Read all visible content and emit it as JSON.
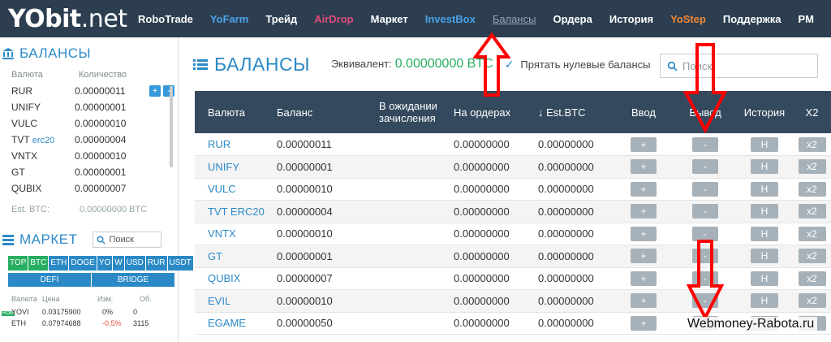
{
  "nav": {
    "logo_main": "YObit",
    "logo_suffix": ".net",
    "items": [
      {
        "label": "RoboTrade",
        "style": "white"
      },
      {
        "label": "YoFarm",
        "style": "blue"
      },
      {
        "label": "Трейд",
        "style": "white"
      },
      {
        "label": "AirDrop",
        "style": "pink"
      },
      {
        "label": "Маркет",
        "style": "white"
      },
      {
        "label": "InvestBox",
        "style": "blue"
      },
      {
        "label": "Балансы",
        "style": "active"
      },
      {
        "label": "Ордера",
        "style": "white"
      },
      {
        "label": "История",
        "style": "white"
      },
      {
        "label": "YoStep",
        "style": "orange"
      },
      {
        "label": "Поддержка",
        "style": "white"
      },
      {
        "label": "PM",
        "style": "white"
      }
    ]
  },
  "sidebar": {
    "title": "БАЛАНСЫ",
    "col_currency": "Валюта",
    "col_amount": "Количество",
    "rows": [
      {
        "currency": "RUR",
        "suffix": "",
        "amount": "0.00000011"
      },
      {
        "currency": "UNIFY",
        "suffix": "",
        "amount": "0.00000001"
      },
      {
        "currency": "VULC",
        "suffix": "",
        "amount": "0.00000010"
      },
      {
        "currency": "TVT",
        "suffix": "erc20",
        "amount": "0.00000004"
      },
      {
        "currency": "VNTX",
        "suffix": "",
        "amount": "0.00000010"
      },
      {
        "currency": "GT",
        "suffix": "",
        "amount": "0.00000001"
      },
      {
        "currency": "QUBIX",
        "suffix": "",
        "amount": "0.00000007"
      }
    ],
    "plus_label": "+",
    "minus_label": "-",
    "est_label": "Est. BTC:",
    "est_value": "0.00000000 BTC"
  },
  "market": {
    "title": "МАРКЕТ",
    "search_placeholder": "Поиск",
    "tabs": [
      "TOP",
      "BTC",
      "ETH",
      "DOGE",
      "YO",
      "W",
      "USD",
      "RUR",
      "USDT"
    ],
    "selected_tab": "BTC",
    "sub_tabs": [
      "DEFI",
      "BRIDGE"
    ],
    "col_currency": "Валюта",
    "col_price": "Цена",
    "col_change": "Изм.",
    "col_volume": "Об.",
    "rows": [
      {
        "badge": "ROM",
        "currency": "YOVI",
        "price": "0.03175900",
        "change": "0%",
        "volume": "0"
      },
      {
        "badge": "",
        "currency": "ETH",
        "price": "0.07974688",
        "change": "-0.5%",
        "volume": "3115"
      }
    ]
  },
  "main": {
    "title": "БАЛАНСЫ",
    "equiv_label": "Эквивалент:",
    "equiv_value": "0.00000000 BTC",
    "hide_zero_label": "Прятать нулевые балансы",
    "search_placeholder": "Поиск",
    "headers": {
      "currency": "Валюта",
      "balance": "Баланс",
      "pending": "В ожидании зачисления",
      "orders": "На ордерах",
      "est": "↓ Est.BTC",
      "deposit": "Ввод",
      "withdraw": "Вывод",
      "history": "История",
      "x2": "X2"
    },
    "deposit_btn": "+",
    "withdraw_btn": "-",
    "history_btn": "H",
    "x2_btn": "x2",
    "rows": [
      {
        "currency": "RUR",
        "balance": "0.00000011",
        "orders": "0.00000000",
        "est": "0.00000000"
      },
      {
        "currency": "UNIFY",
        "balance": "0.00000001",
        "orders": "0.00000000",
        "est": "0.00000000"
      },
      {
        "currency": "VULC",
        "balance": "0.00000010",
        "orders": "0.00000000",
        "est": "0.00000000"
      },
      {
        "currency": "TVT ERC20",
        "balance": "0.00000004",
        "orders": "0.00000000",
        "est": "0.00000000"
      },
      {
        "currency": "VNTX",
        "balance": "0.00000010",
        "orders": "0.00000000",
        "est": "0.00000000"
      },
      {
        "currency": "GT",
        "balance": "0.00000001",
        "orders": "0.00000000",
        "est": "0.00000000"
      },
      {
        "currency": "QUBIX",
        "balance": "0.00000007",
        "orders": "0.00000000",
        "est": "0.00000000"
      },
      {
        "currency": "EVIL",
        "balance": "0.00000010",
        "orders": "0.00000000",
        "est": "0.00000000"
      },
      {
        "currency": "EGAME",
        "balance": "0.00000050",
        "orders": "0.00000000",
        "est": "0.00000000"
      }
    ]
  },
  "watermark": "Webmoney-Rabota.ru",
  "colors": {
    "nav_bg": "#2c3e50",
    "accent_blue": "#2b8ac6",
    "green": "#27ae60",
    "arrow_red": "#ff0000"
  }
}
